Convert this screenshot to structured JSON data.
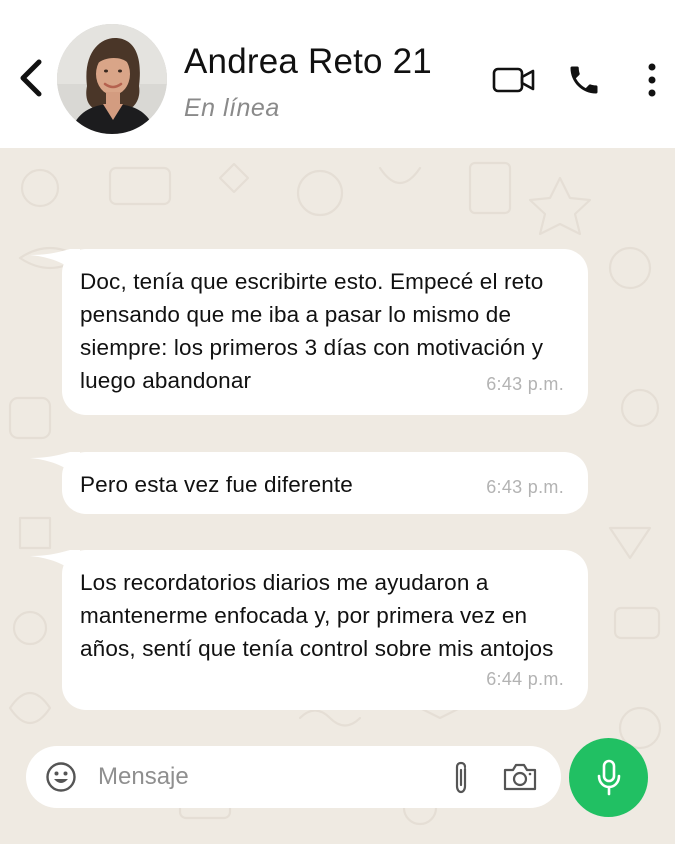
{
  "header": {
    "contact_name": "Andrea Reto 21",
    "status": "En línea",
    "back_icon": "chevron-left-icon",
    "avatar_icon": "contact-photo",
    "video_icon": "video-camera-icon",
    "call_icon": "phone-icon",
    "menu_icon": "more-vertical-icon"
  },
  "messages": [
    {
      "text": "Doc, tenía que escribirte esto. Empecé el reto pensando que me iba a pasar lo mismo de siempre: los primeros 3 días con motivación y luego abandonar",
      "time": "6:43 p.m."
    },
    {
      "text": "Pero esta vez fue diferente",
      "time": "6:43 p.m."
    },
    {
      "text": "Los recordatorios diarios me ayudaron a mantenerme enfocada y, por primera vez en años, sentí que tenía control sobre mis antojos",
      "time": "6:44 p.m."
    }
  ],
  "composer": {
    "placeholder": "Mensaje",
    "value": "",
    "emoji_icon": "emoji-icon",
    "attach_icon": "paperclip-icon",
    "camera_icon": "camera-icon",
    "mic_icon": "microphone-icon"
  },
  "colors": {
    "header_bg": "#ffffff",
    "chat_bg": "#efeae2",
    "bubble_bg": "#ffffff",
    "mic_bg": "#21c063",
    "time_text": "#b3b3b3",
    "status_text": "#8a8a8a"
  }
}
